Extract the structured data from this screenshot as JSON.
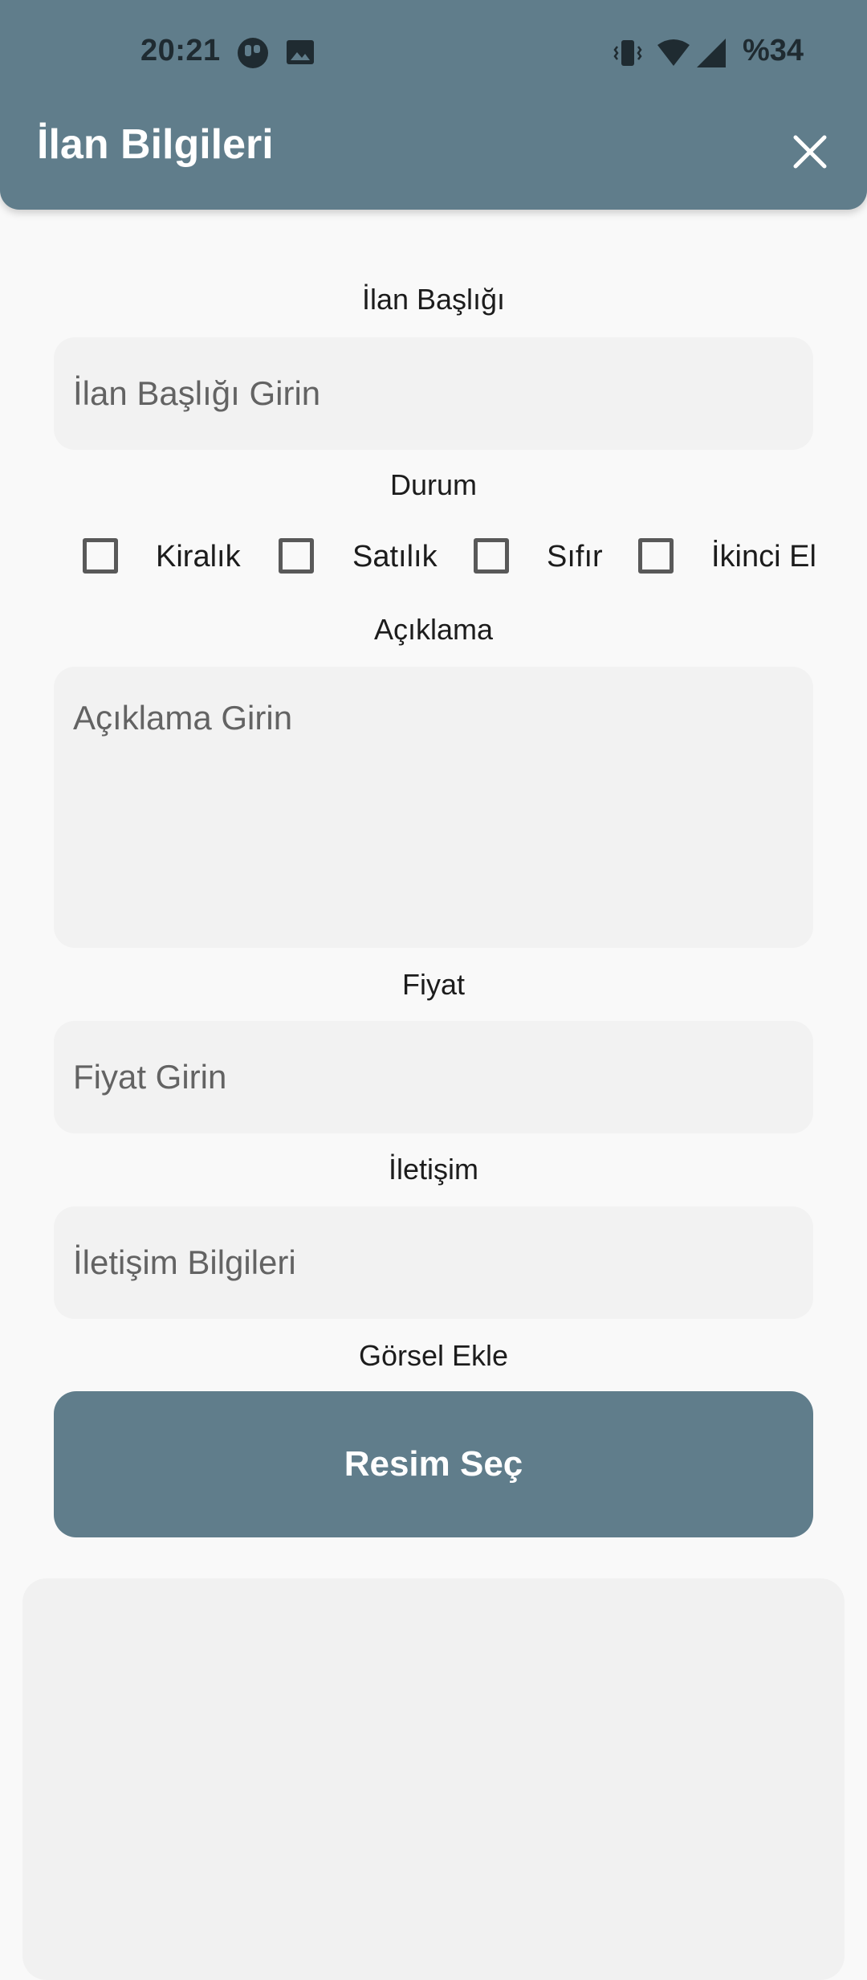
{
  "status_bar": {
    "time": "20:21",
    "battery": "%34",
    "icons": [
      "app-notification-icon",
      "image-notification-icon",
      "vibrate-icon",
      "wifi-icon",
      "cell-signal-icon"
    ]
  },
  "app_bar": {
    "title": "İlan Bilgileri",
    "close_icon": "close-icon",
    "color": "#607d8b"
  },
  "form": {
    "title_label": "İlan Başlığı",
    "title_placeholder": "İlan Başlığı Girin",
    "status_label": "Durum",
    "status_options": [
      {
        "label": "Kiralık",
        "checked": false
      },
      {
        "label": "Satılık",
        "checked": false
      },
      {
        "label": "Sıfır",
        "checked": false
      },
      {
        "label": "İkinci El",
        "checked": false
      }
    ],
    "description_label": "Açıklama",
    "description_placeholder": "Açıklama Girin",
    "price_label": "Fiyat",
    "price_placeholder": "Fiyat Girin",
    "contact_label": "İletişim",
    "contact_placeholder": "İletişim Bilgileri",
    "image_label": "Görsel Ekle",
    "select_image_button": "Resim Seç"
  }
}
